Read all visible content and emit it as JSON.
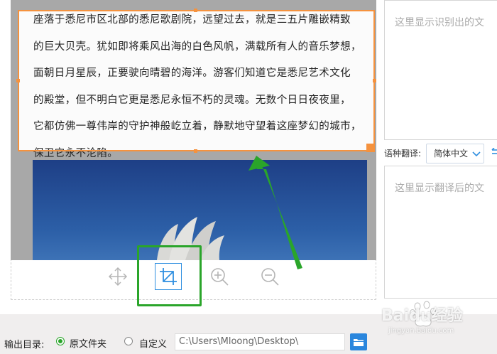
{
  "document": {
    "lines": [
      "座落于悉尼市区北部的悉尼歌剧院，远望过去，就是三五片雕嵌精致",
      "的巨大贝壳。犹如即将乘风出海的白色风帆，满载所有人的音乐梦想，",
      "面朝日月星辰，正要驶向晴碧的海洋。游客们知道它是悉尼艺术文化",
      "的殿堂，但不明白它更是悉尼永恒不朽的灵魂。无数个日日夜夜里，",
      "它都仿佛一尊伟岸的守护神般屹立着，静默地守望着这座梦幻的城市，",
      "保卫它永不沦陷。"
    ]
  },
  "toolbar": {
    "tools": [
      {
        "name": "move-tool",
        "icon": "move-arrows-icon",
        "active": false
      },
      {
        "name": "crop-tool",
        "icon": "crop-icon",
        "active": true
      },
      {
        "name": "zoom-in-tool",
        "icon": "zoom-in-icon",
        "active": false
      },
      {
        "name": "zoom-out-tool",
        "icon": "zoom-out-icon",
        "active": false
      }
    ]
  },
  "right_panel": {
    "recognized_placeholder": "这里显示识别出的文",
    "translation_label": "语种翻译:",
    "language_value": "简体中文",
    "translated_placeholder": "这里显示翻译后的文"
  },
  "bottom_bar": {
    "output_label": "输出目录:",
    "option_original": "原文件夹",
    "option_custom": "自定义",
    "path_value": "C:\\Users\\Mloong\\Desktop\\",
    "selected_option": "original"
  },
  "watermark": {
    "brand": "Baidu经验",
    "url": "jingyan.baidu.com"
  },
  "colors": {
    "selection": "#f5923e",
    "annotation_green": "#2aa52a",
    "accent_blue": "#2a86dd"
  }
}
